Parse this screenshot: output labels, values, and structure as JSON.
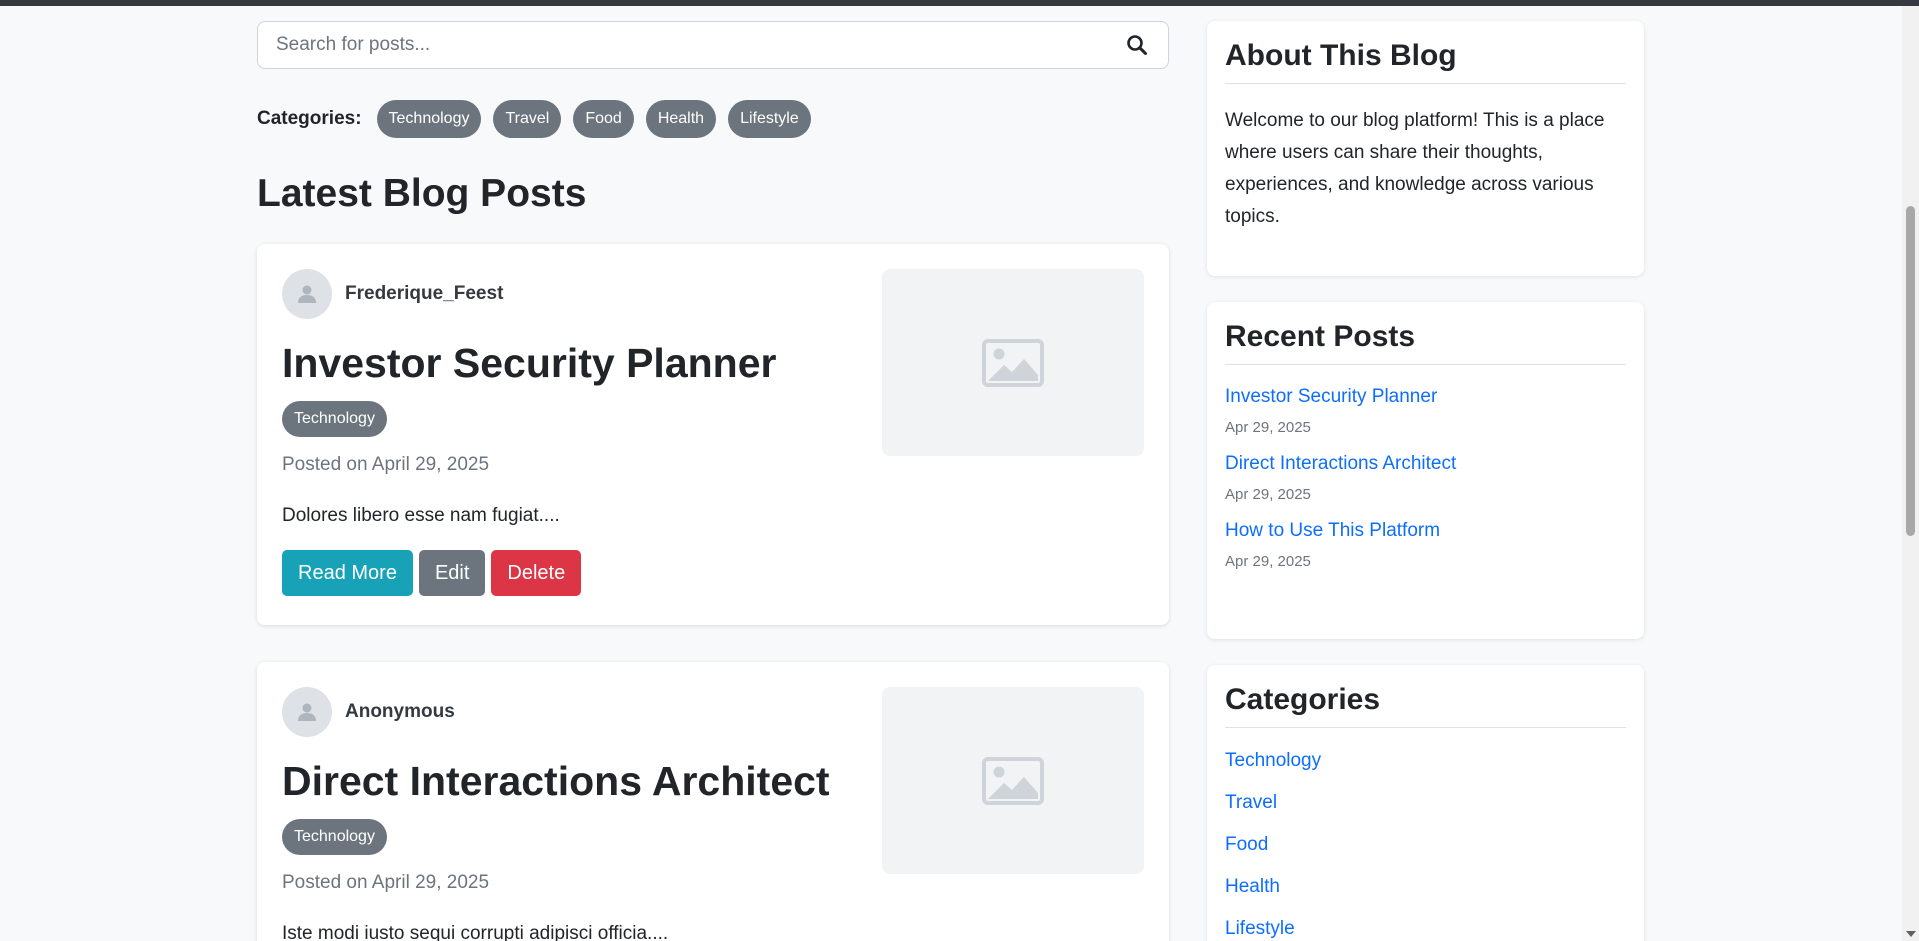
{
  "search": {
    "placeholder": "Search for posts..."
  },
  "categories_bar": {
    "label": "Categories:",
    "items": [
      "Technology",
      "Travel",
      "Food",
      "Health",
      "Lifestyle"
    ]
  },
  "section_title": "Latest Blog Posts",
  "posts": [
    {
      "author": "Frederique_Feest",
      "title": "Investor Security Planner",
      "tag": "Technology",
      "date": "Posted on April 29, 2025",
      "excerpt": "Dolores libero esse nam fugiat....",
      "buttons": {
        "read": "Read More",
        "edit": "Edit",
        "delete": "Delete"
      }
    },
    {
      "author": "Anonymous",
      "title": "Direct Interactions Architect",
      "tag": "Technology",
      "date": "Posted on April 29, 2025",
      "excerpt": "Iste modi iusto sequi corrupti adipisci officia...."
    }
  ],
  "sidebar": {
    "about": {
      "title": "About This Blog",
      "text": "Welcome to our blog platform! This is a place where users can share their thoughts, experiences, and knowledge across various topics."
    },
    "recent": {
      "title": "Recent Posts",
      "items": [
        {
          "title": "Investor Security Planner",
          "date": "Apr 29, 2025"
        },
        {
          "title": "Direct Interactions Architect",
          "date": "Apr 29, 2025"
        },
        {
          "title": "How to Use This Platform",
          "date": "Apr 29, 2025"
        }
      ]
    },
    "categories": {
      "title": "Categories",
      "items": [
        "Technology",
        "Travel",
        "Food",
        "Health",
        "Lifestyle"
      ]
    }
  },
  "colors": {
    "link": "#0d6efd",
    "pill": "#6c757d",
    "read_button": "#17a2b8",
    "edit_button": "#6c757d",
    "delete_button": "#dc3545",
    "page_background": "#f8f9fa"
  }
}
